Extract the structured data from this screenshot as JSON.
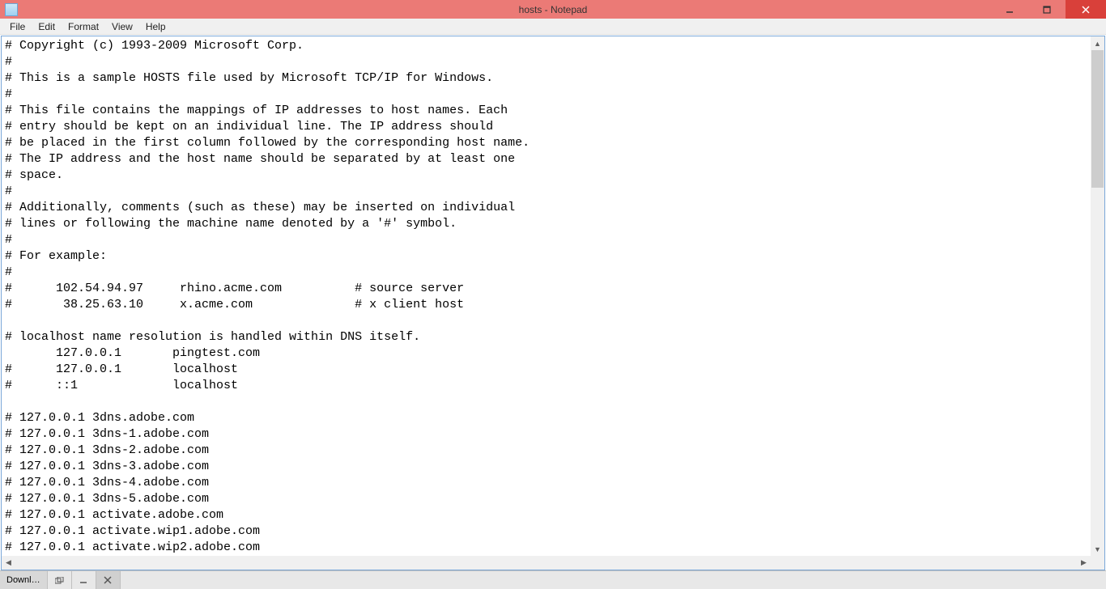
{
  "window": {
    "title": "hosts - Notepad"
  },
  "menubar": {
    "items": [
      "File",
      "Edit",
      "Format",
      "View",
      "Help"
    ]
  },
  "editor": {
    "content": "# Copyright (c) 1993-2009 Microsoft Corp.\n#\n# This is a sample HOSTS file used by Microsoft TCP/IP for Windows.\n#\n# This file contains the mappings of IP addresses to host names. Each\n# entry should be kept on an individual line. The IP address should\n# be placed in the first column followed by the corresponding host name.\n# The IP address and the host name should be separated by at least one\n# space.\n#\n# Additionally, comments (such as these) may be inserted on individual\n# lines or following the machine name denoted by a '#' symbol.\n#\n# For example:\n#\n#      102.54.94.97     rhino.acme.com          # source server\n#       38.25.63.10     x.acme.com              # x client host\n\n# localhost name resolution is handled within DNS itself.\n       127.0.0.1       pingtest.com\n#      127.0.0.1       localhost\n#      ::1             localhost\n\n# 127.0.0.1 3dns.adobe.com\n# 127.0.0.1 3dns-1.adobe.com\n# 127.0.0.1 3dns-2.adobe.com\n# 127.0.0.1 3dns-3.adobe.com\n# 127.0.0.1 3dns-4.adobe.com\n# 127.0.0.1 3dns-5.adobe.com\n# 127.0.0.1 activate.adobe.com\n# 127.0.0.1 activate.wip1.adobe.com\n# 127.0.0.1 activate.wip2.adobe.com"
  },
  "taskbar": {
    "item": "Downl…"
  }
}
